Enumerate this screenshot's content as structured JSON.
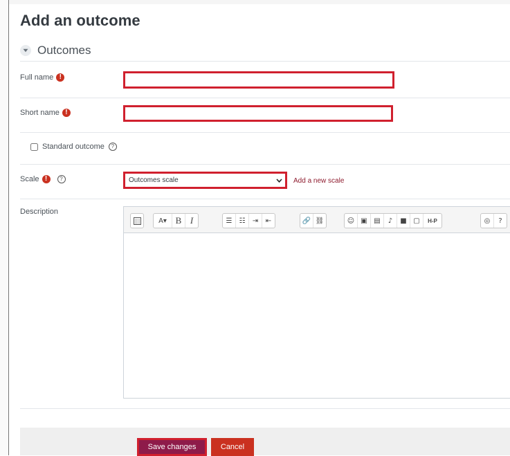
{
  "page": {
    "title": "Add an outcome"
  },
  "section": {
    "title": "Outcomes"
  },
  "form": {
    "full_name": {
      "label": "Full name",
      "value": ""
    },
    "short_name": {
      "label": "Short name",
      "value": ""
    },
    "standard_outcome": {
      "label": "Standard outcome",
      "checked": false
    },
    "scale": {
      "label": "Scale",
      "selected": "Outcomes scale",
      "add_link": "Add a new scale"
    },
    "description": {
      "label": "Description"
    }
  },
  "editor": {
    "toolbar_icons": [
      "collapse-icon",
      "font-style-icon",
      "bold-icon",
      "italic-icon",
      "unordered-list-icon",
      "ordered-list-icon",
      "indent-icon",
      "outdent-icon",
      "link-icon",
      "unlink-icon",
      "emoji-icon",
      "image-icon",
      "media-icon",
      "record-audio-icon",
      "record-video-icon",
      "manage-files-icon",
      "h5p-icon",
      "accessibility-checker-icon",
      "screenreader-helper-icon"
    ],
    "glyphs": {
      "font": "A▾",
      "bold": "B",
      "italic": "I",
      "h5p": "H-P"
    }
  },
  "buttons": {
    "save": "Save changes",
    "cancel": "Cancel"
  },
  "colors": {
    "required": "#ca3120",
    "highlight": "#d0202e",
    "primary": "#8e1b4a",
    "link": "#8e1b2e"
  }
}
